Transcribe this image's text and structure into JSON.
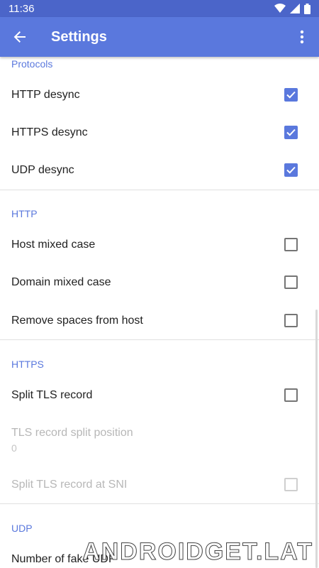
{
  "status_bar": {
    "time": "11:36"
  },
  "app_bar": {
    "title": "Settings"
  },
  "sections": {
    "protocols": {
      "header": "Protocols",
      "items": [
        {
          "label": "HTTP desync",
          "checked": true
        },
        {
          "label": "HTTPS desync",
          "checked": true
        },
        {
          "label": "UDP desync",
          "checked": true
        }
      ]
    },
    "http": {
      "header": "HTTP",
      "items": [
        {
          "label": "Host mixed case",
          "checked": false
        },
        {
          "label": "Domain mixed case",
          "checked": false
        },
        {
          "label": "Remove spaces from host",
          "checked": false
        }
      ]
    },
    "https": {
      "header": "HTTPS",
      "items": [
        {
          "label": "Split TLS record",
          "checked": false
        },
        {
          "label": "TLS record split position",
          "summary": "0",
          "disabled": true
        },
        {
          "label": "Split TLS record at SNI",
          "checked": false,
          "disabled": true
        }
      ]
    },
    "udp": {
      "header": "UDP",
      "items": [
        {
          "label": "Number of fake UDP"
        }
      ]
    }
  },
  "watermark": "ANDROIDGET.LAT",
  "colors": {
    "status_bar": "#4b65c9",
    "app_bar": "#5a78dd",
    "accent": "#5a78dd"
  }
}
